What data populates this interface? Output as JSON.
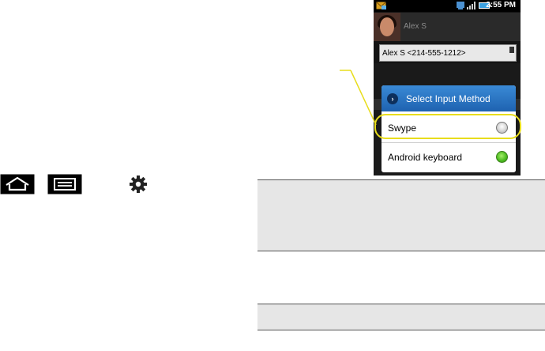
{
  "phone": {
    "status_time": "2:55 PM",
    "contact_name": "Alex S",
    "recipient_field": "Alex S <214-555-1212>",
    "dialog": {
      "title": "Select Input Method",
      "options": [
        {
          "label": "Swype",
          "selected": false
        },
        {
          "label": "Android keyboard",
          "selected": true
        }
      ]
    }
  },
  "icons": [
    "home-icon",
    "menu-icon",
    "settings-gear-icon"
  ],
  "colors": {
    "highlight": "#e8dd1c",
    "dialog_title": "#2a75c4",
    "radio_selected": "#4fbe23",
    "note_box": "#e6e6e6"
  }
}
